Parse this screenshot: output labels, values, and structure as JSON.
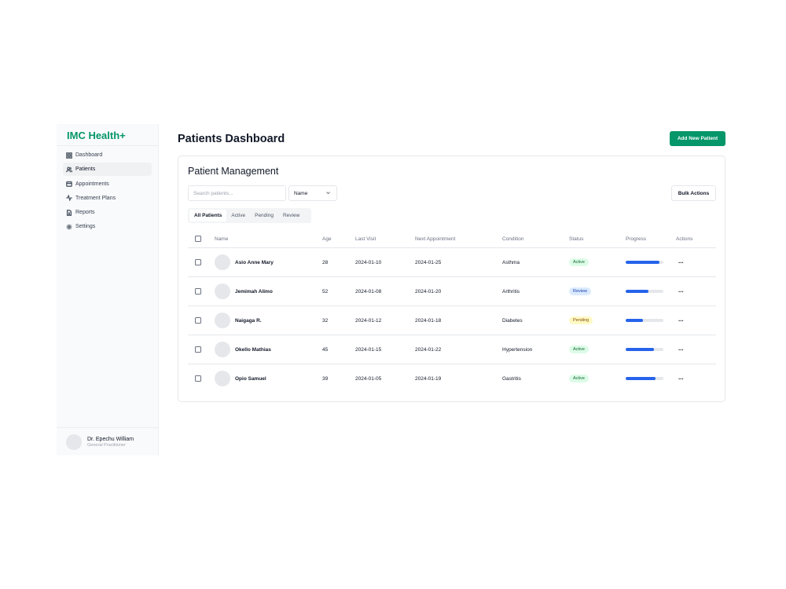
{
  "app": {
    "brand": "IMC Health+"
  },
  "sidebar": {
    "items": [
      {
        "label": "Dashboard",
        "icon": "dashboard-icon",
        "active": false
      },
      {
        "label": "Patients",
        "icon": "users-icon",
        "active": true
      },
      {
        "label": "Appointments",
        "icon": "calendar-icon",
        "active": false
      },
      {
        "label": "Treatment Plans",
        "icon": "activity-icon",
        "active": false
      },
      {
        "label": "Reports",
        "icon": "file-icon",
        "active": false
      },
      {
        "label": "Settings",
        "icon": "gear-icon",
        "active": false
      }
    ],
    "user": {
      "name": "Dr. Epechu William",
      "role": "General Practitioner"
    }
  },
  "header": {
    "title": "Patients Dashboard",
    "add_button": "Add New Patient"
  },
  "card": {
    "title": "Patient Management",
    "search_placeholder": "Search patients...",
    "sort_select": "Name",
    "bulk_button": "Bulk Actions",
    "tabs": [
      "All Patients",
      "Active",
      "Pending",
      "Review"
    ],
    "active_tab": "All Patients"
  },
  "table": {
    "columns": [
      "Name",
      "Age",
      "Last Visit",
      "Next Appointment",
      "Condition",
      "Status",
      "Progress",
      "Actions"
    ],
    "rows": [
      {
        "name": "Asio Anne Mary",
        "age": "28",
        "last_visit": "2024-01-10",
        "next_appointment": "2024-01-25",
        "condition": "Asthma",
        "status": "Active",
        "progress": 0.9
      },
      {
        "name": "Jemimah Alimo",
        "age": "52",
        "last_visit": "2024-01-08",
        "next_appointment": "2024-01-20",
        "condition": "Arthritis",
        "status": "Review",
        "progress": 0.6
      },
      {
        "name": "Naigaga R.",
        "age": "32",
        "last_visit": "2024-01-12",
        "next_appointment": "2024-01-18",
        "condition": "Diabetes",
        "status": "Pending",
        "progress": 0.45
      },
      {
        "name": "Okello Mathias",
        "age": "45",
        "last_visit": "2024-01-15",
        "next_appointment": "2024-01-22",
        "condition": "Hypertension",
        "status": "Active",
        "progress": 0.75
      },
      {
        "name": "Opio Samuel",
        "age": "39",
        "last_visit": "2024-01-05",
        "next_appointment": "2024-01-19",
        "condition": "Gastritis",
        "status": "Active",
        "progress": 0.8
      }
    ],
    "actions_glyph": "···"
  },
  "colors": {
    "brand": "#059669",
    "progress": "#2563eb",
    "active_badge": "#dcfce7",
    "review_badge": "#dbeafe",
    "pending_badge": "#fef9c3"
  }
}
